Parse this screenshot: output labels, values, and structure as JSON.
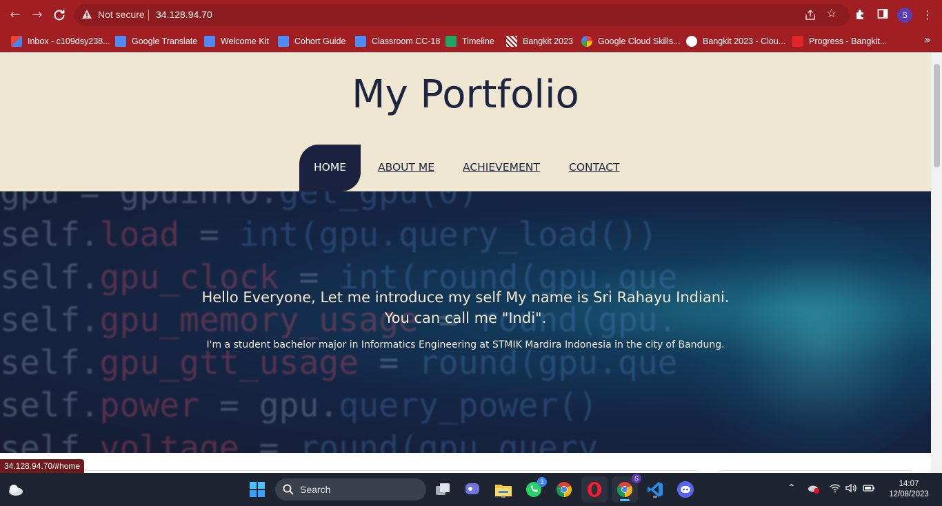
{
  "browser": {
    "not_secure_label": "Not secure",
    "url": "34.128.94.70",
    "profile_initial": "S",
    "theme_color": "#a11e22"
  },
  "bookmarks": [
    {
      "label": "Inbox - c109dsy238...",
      "icon": "gmail-icon",
      "color": "#ffffff"
    },
    {
      "label": "Google Translate",
      "icon": "translate-icon",
      "color": "#4c8bf5"
    },
    {
      "label": "Welcome Kit",
      "icon": "docs-icon",
      "color": "#4c8bf5"
    },
    {
      "label": "Cohort Guide",
      "icon": "docs-icon",
      "color": "#4c8bf5"
    },
    {
      "label": "Classroom CC-18",
      "icon": "classroom-icon",
      "color": "#4c8bf5"
    },
    {
      "label": "Timeline",
      "icon": "sheets-icon",
      "color": "#1fa463"
    },
    {
      "label": "Bangkit 2023",
      "icon": "bangkit-icon",
      "color": "#ffffff"
    },
    {
      "label": "Google Cloud Skills...",
      "icon": "cloud-skills-icon",
      "color": "#f4b400"
    },
    {
      "label": "Bangkit 2023 - Clou...",
      "icon": "c-icon",
      "color": "#ffffff"
    },
    {
      "label": "Progress - Bangkit...",
      "icon": "progress-icon",
      "color": "#e0242a"
    }
  ],
  "site": {
    "title": "My Portfolio",
    "nav": [
      {
        "label": "HOME",
        "active": true
      },
      {
        "label": "ABOUT ME",
        "active": false
      },
      {
        "label": "ACHIEVEMENT",
        "active": false
      },
      {
        "label": "CONTACT",
        "active": false
      }
    ],
    "hero": {
      "heading": "Hello Everyone, Let me introduce my self My name is Sri Rahayu Indiani. You can call me \"Indi\".",
      "subtext": "I'm a student bachelor major in Informatics Engineering at STMIK Mardira Indonesia in the city of Bandung."
    },
    "header_bg": "#efe7d1",
    "accent": "#1a2240"
  },
  "status_url": "34.128.94.70/#home",
  "taskbar": {
    "search_label": "Search",
    "whatsapp_badge": "3",
    "time": "14:07",
    "date": "12/08/2023"
  }
}
